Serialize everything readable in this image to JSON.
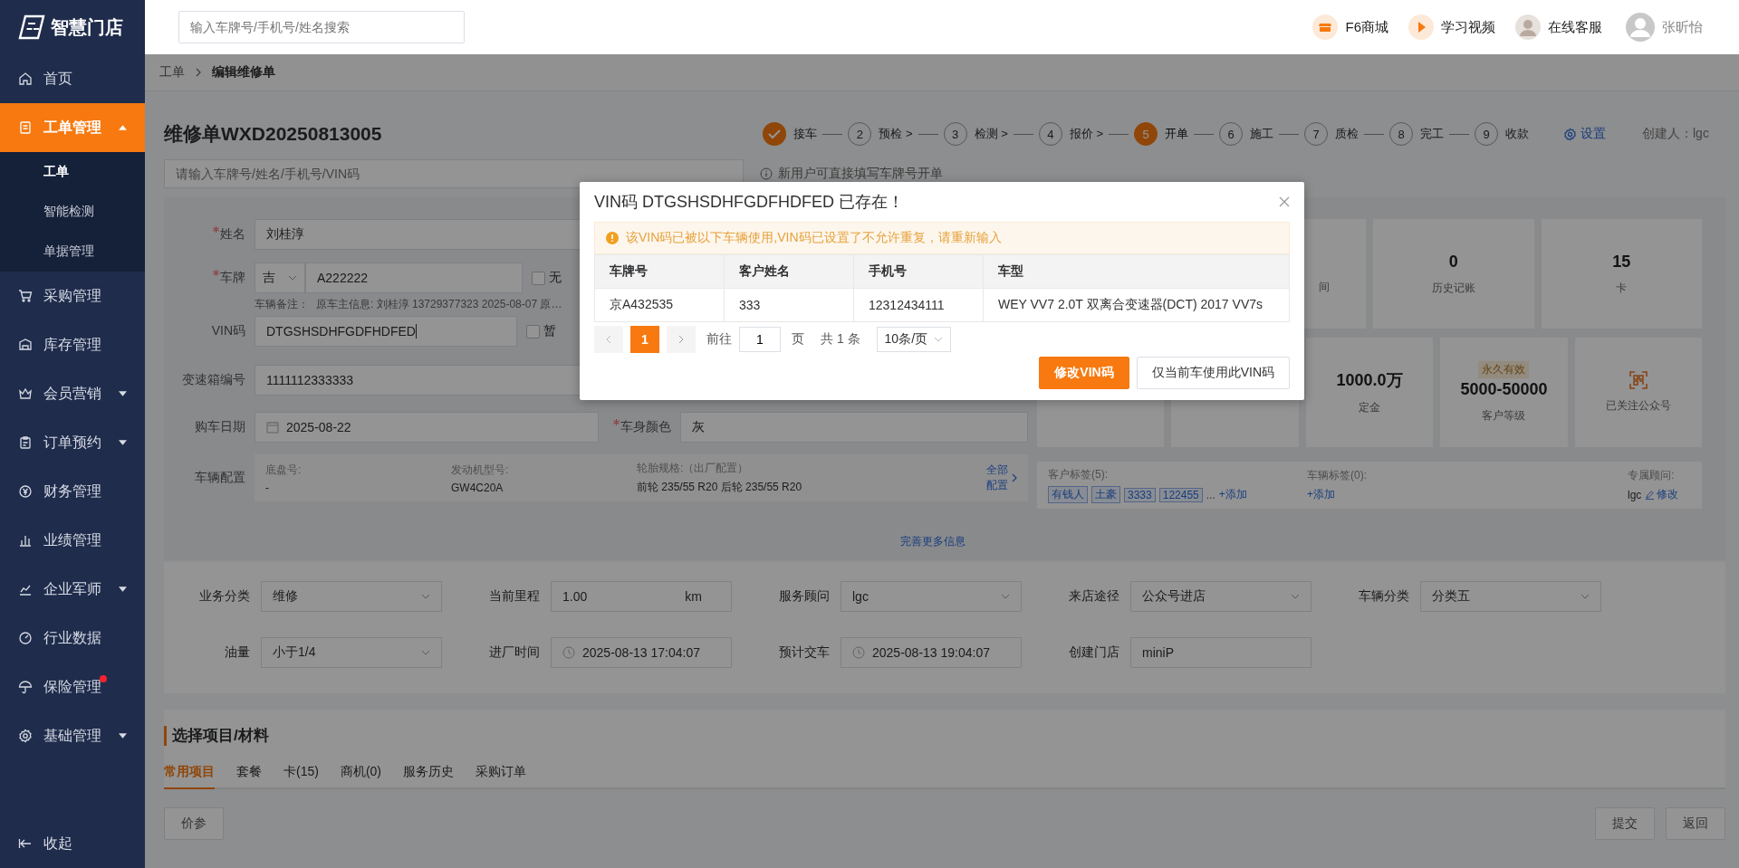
{
  "sidebar": {
    "logo": "智慧门店",
    "items": [
      {
        "label": "首页",
        "kind": "link",
        "selected": false,
        "alert": false
      },
      {
        "label": "工单管理",
        "kind": "group",
        "selected": true,
        "expanded": true,
        "alert": false,
        "children": [
          {
            "label": "工单",
            "selected": true
          },
          {
            "label": "智能检测",
            "selected": false
          },
          {
            "label": "单据管理",
            "selected": false
          }
        ]
      },
      {
        "label": "采购管理",
        "kind": "link",
        "selected": false,
        "alert": false
      },
      {
        "label": "库存管理",
        "kind": "link",
        "selected": false,
        "alert": false
      },
      {
        "label": "会员营销",
        "kind": "group",
        "selected": false,
        "expanded": false,
        "alert": false
      },
      {
        "label": "订单预约",
        "kind": "group",
        "selected": false,
        "expanded": false,
        "alert": false
      },
      {
        "label": "财务管理",
        "kind": "link",
        "selected": false,
        "alert": false
      },
      {
        "label": "业绩管理",
        "kind": "link",
        "selected": false,
        "alert": false
      },
      {
        "label": "企业军师",
        "kind": "group",
        "selected": false,
        "expanded": false,
        "alert": false
      },
      {
        "label": "行业数据",
        "kind": "link",
        "selected": false,
        "alert": false
      },
      {
        "label": "保险管理",
        "kind": "link",
        "selected": false,
        "alert": true
      },
      {
        "label": "基础管理",
        "kind": "group",
        "selected": false,
        "expanded": false,
        "alert": false
      }
    ],
    "collapse": "收起"
  },
  "header": {
    "search_placeholder": "输入车牌号/手机号/姓名搜索",
    "links": [
      {
        "label": "F6商城"
      },
      {
        "label": "学习视频"
      },
      {
        "label": "在线客服"
      }
    ],
    "user": "张昕怡"
  },
  "breadcrumb": [
    "工单",
    "编辑维修单"
  ],
  "order": {
    "title": "维修单WXD20250813005",
    "steps": [
      {
        "label": "接车",
        "done": true,
        "current": false
      },
      {
        "number": "2",
        "label": "预检 >",
        "done": false,
        "current": false
      },
      {
        "number": "3",
        "label": "检测 >",
        "done": false,
        "current": false
      },
      {
        "number": "4",
        "label": "报价 >",
        "done": false,
        "current": false
      },
      {
        "number": "5",
        "label": "开单",
        "done": false,
        "current": true
      },
      {
        "number": "6",
        "label": "施工",
        "done": false,
        "current": false
      },
      {
        "number": "7",
        "label": "质检",
        "done": false,
        "current": false
      },
      {
        "number": "8",
        "label": "完工",
        "done": false,
        "current": false
      },
      {
        "number": "9",
        "label": "收款",
        "done": false,
        "current": false
      }
    ],
    "settings": "设置",
    "creator": "创建人：lgc"
  },
  "search": {
    "placeholder": "请输入车牌号/姓名/手机号/VIN码",
    "hint": "新用户可直接填写车牌号开单"
  },
  "vehicle_form": {
    "name": {
      "label": "姓名",
      "required": true,
      "value": "刘桂淳"
    },
    "plate": {
      "label": "车牌",
      "required": true,
      "province": "吉",
      "value": "A222222",
      "option": {
        "label": "无",
        "checked": false
      },
      "note_label": "车辆备注：",
      "note": "原车主信息: 刘桂淳 13729377323 2025-08-07 原…"
    },
    "vin": {
      "label": "VIN码",
      "required": false,
      "value": "DTGSHSDHFGDFHDFED",
      "option": {
        "label": "暂",
        "checked": false
      }
    },
    "gearbox": {
      "label": "变速箱编号",
      "required": false,
      "value": "1111112333333"
    },
    "purchase_date": {
      "label": "购车日期",
      "required": false,
      "value": "2025-08-22"
    },
    "body_color": {
      "label": "车身颜色",
      "required": true,
      "value": "灰"
    },
    "config": {
      "label": "车辆配置",
      "items": [
        {
          "label": "底盘号:",
          "value": "-"
        },
        {
          "label": "发动机型号:",
          "value": "GW4C20A"
        },
        {
          "label": "轮胎规格:（出厂配置）",
          "value": "前轮 235/55 R20 后轮 235/55 R20"
        }
      ],
      "link": "全部配置"
    },
    "more": "完善更多信息"
  },
  "stats_top": [
    {
      "label": "间"
    },
    {
      "value": "0",
      "label": "历史记账"
    },
    {
      "value": "15",
      "label": "卡"
    }
  ],
  "stats_bottom": [
    {
      "kind": "number",
      "value": "1000.0万",
      "label": "定金"
    },
    {
      "kind": "number",
      "tag": "永久有效",
      "value": "5000-50000",
      "label": "客户等级"
    },
    {
      "kind": "qr",
      "label": "已关注公众号"
    }
  ],
  "tags": {
    "customer": {
      "label": "客户标签(5):",
      "tags": [
        "有钱人",
        "土豪",
        "3333",
        "122455"
      ],
      "more": "...",
      "add": "+添加"
    },
    "vehicle": {
      "label": "车辆标签(0):",
      "add": "+添加"
    },
    "advisor": {
      "label": "专属顾问:",
      "value": "lgc",
      "edit": "修改"
    }
  },
  "order_fields": [
    {
      "label": "业务分类",
      "value": "维修",
      "kind": "select"
    },
    {
      "label": "当前里程",
      "value": "1.00",
      "unit": "km",
      "kind": "unit"
    },
    {
      "label": "服务顾问",
      "value": "lgc",
      "kind": "select"
    },
    {
      "label": "来店途径",
      "value": "公众号进店",
      "kind": "select"
    },
    {
      "label": "车辆分类",
      "value": "分类五",
      "kind": "select"
    },
    {
      "label": "油量",
      "value": "小于1/4",
      "kind": "select"
    },
    {
      "label": "进厂时间",
      "value": "2025-08-13 17:04:07",
      "kind": "time"
    },
    {
      "label": "预计交车",
      "value": "2025-08-13 19:04:07",
      "kind": "time"
    },
    {
      "label": "创建门店",
      "value": "miniP",
      "kind": "text"
    }
  ],
  "items_section": {
    "title": "选择项目/材料",
    "tabs": [
      {
        "label": "常用项目",
        "selected": true
      },
      {
        "label": "套餐",
        "selected": false
      },
      {
        "label": "卡(15)",
        "selected": false
      },
      {
        "label": "商机(0)",
        "selected": false
      },
      {
        "label": "服务历史",
        "selected": false
      },
      {
        "label": "采购订单",
        "selected": false
      }
    ],
    "button": "价参"
  },
  "footer_buttons": [
    "提交",
    "返回"
  ],
  "modal": {
    "title": "VIN码 DTGSHSDHFGDFHDFED 已存在！",
    "warning": "该VIN码已被以下车辆使用,VIN码已设置了不允许重复，请重新输入",
    "columns": [
      "车牌号",
      "客户姓名",
      "手机号",
      "车型"
    ],
    "rows": [
      [
        "京A432535",
        "333",
        "12312434111",
        "WEY VV7 2.0T 双离合变速器(DCT) 2017 VV7s"
      ]
    ],
    "pagination": {
      "pages": [
        {
          "label": "1",
          "selected": true
        }
      ],
      "goto_label": "前往",
      "goto_value": "1",
      "page_unit": "页",
      "total": "共 1 条",
      "page_size": "10条/页"
    },
    "buttons": [
      {
        "label": "修改VIN码",
        "kind": "primary"
      },
      {
        "label": "仅当前车使用此VIN码",
        "kind": "default"
      }
    ]
  }
}
